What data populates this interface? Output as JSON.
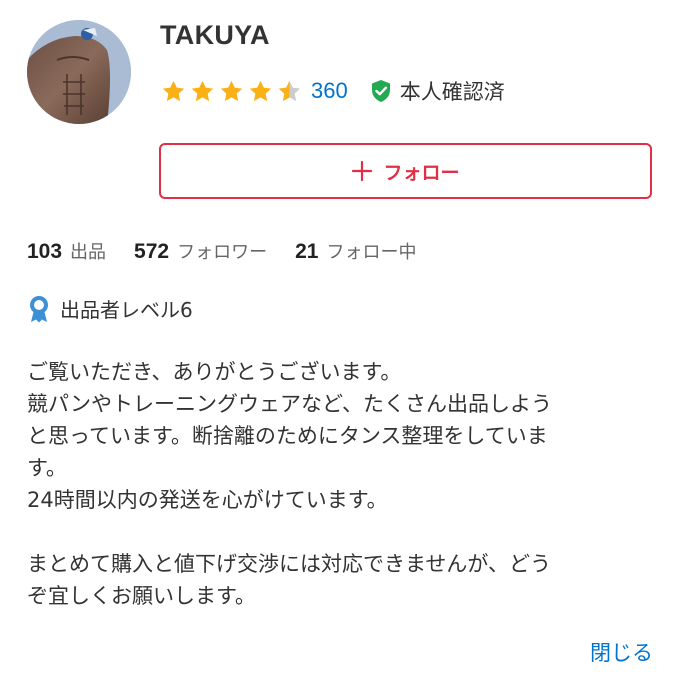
{
  "profile": {
    "username": "TAKUYA",
    "rating": 4.5,
    "review_count": "360",
    "verified_label": "本人確認済",
    "verified_color": "#23a94f"
  },
  "follow_button": {
    "label": "フォロー",
    "icon": "plus-icon",
    "color": "#e02f46"
  },
  "stats": [
    {
      "value": "103",
      "label": "出品"
    },
    {
      "value": "572",
      "label": "フォロワー"
    },
    {
      "value": "21",
      "label": "フォロー中"
    }
  ],
  "seller_level": {
    "icon": "badge-icon",
    "label": "出品者レベル6"
  },
  "bio": {
    "lines": [
      "ご覧いただき、ありがとうございます。",
      "競パンやトレーニングウェアなど、たくさん出品しよう",
      "と思っています。断捨離のためにタンス整理をしていま",
      "す。",
      "24時間以内の発送を心がけています。",
      "",
      "まとめて購入と値下げ交渉には対応できませんが、どう",
      "ぞ宜しくお願いします。"
    ]
  },
  "close_link": {
    "label": "閉じる"
  },
  "colors": {
    "star": "#fbb116",
    "star_empty": "#cccccc",
    "link": "#0073cc",
    "level_badge": "#3d8fd6"
  }
}
